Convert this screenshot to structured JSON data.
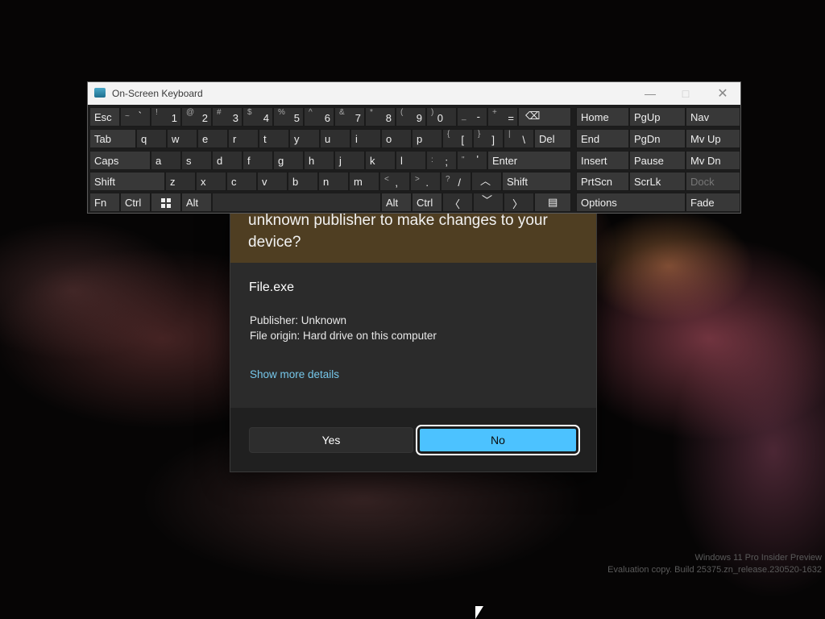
{
  "osk": {
    "title": "On-Screen Keyboard",
    "controls": {
      "minimize": "—",
      "maximize": "□",
      "close": "✕"
    }
  },
  "uac": {
    "question": "unknown publisher to make changes to your device?",
    "filename": "File.exe",
    "publisher": "Publisher: Unknown",
    "origin": "File origin: Hard drive on this computer",
    "more_details": "Show more details",
    "yes_label": "Yes",
    "no_label": "No"
  },
  "watermark": {
    "line1": "Windows 11 Pro Insider Preview",
    "line2": "Evaluation copy. Build 25375.zn_release.230520-1632"
  },
  "keys": {
    "esc": "Esc",
    "tilde_s": "~",
    "tilde_b": "`",
    "k1s": "!",
    "k1": "1",
    "k2s": "@",
    "k2": "2",
    "k3s": "#",
    "k3": "3",
    "k4s": "$",
    "k4": "4",
    "k5s": "%",
    "k5": "5",
    "k6s": "^",
    "k6": "6",
    "k7s": "&",
    "k7": "7",
    "k8s": "*",
    "k8": "8",
    "k9s": "(",
    "k9": "9",
    "k0s": ")",
    "k0": "0",
    "minus_s": "_",
    "minus": "-",
    "eq_s": "+",
    "eq": "=",
    "bksp": "⌫",
    "tab": "Tab",
    "q": "q",
    "w": "w",
    "e": "e",
    "r": "r",
    "t": "t",
    "y": "y",
    "u": "u",
    "i": "i",
    "o": "o",
    "p": "p",
    "lbr_s": "{",
    "lbr": "[",
    "rbr_s": "}",
    "rbr": "]",
    "bsl_s": "|",
    "bsl": "\\",
    "del": "Del",
    "caps": "Caps",
    "a": "a",
    "s": "s",
    "d": "d",
    "f": "f",
    "g": "g",
    "h": "h",
    "j": "j",
    "k": "k",
    "l": "l",
    "semi_s": ":",
    "semi": ";",
    "quot_s": "\"",
    "quot": "'",
    "enter": "Enter",
    "lshift": "Shift",
    "z": "z",
    "x": "x",
    "c": "c",
    "v": "v",
    "b": "b",
    "n": "n",
    "m": "m",
    "comma_s": "<",
    "comma": ",",
    "period_s": ">",
    "period": ".",
    "slash_s": "?",
    "slash": "/",
    "up": "︿",
    "rshift": "Shift",
    "fn": "Fn",
    "lctrl": "Ctrl",
    "alt": "Alt",
    "ralt": "Alt",
    "rctrl": "Ctrl",
    "left": "〈",
    "down": "﹀",
    "right": "〉",
    "menu": "▤",
    "home": "Home",
    "pgup": "PgUp",
    "nav": "Nav",
    "end": "End",
    "pgdn": "PgDn",
    "mvup": "Mv Up",
    "insert": "Insert",
    "pause": "Pause",
    "mvdn": "Mv Dn",
    "prtscn": "PrtScn",
    "scrlk": "ScrLk",
    "dock": "Dock",
    "options": "Options",
    "fade": "Fade"
  }
}
